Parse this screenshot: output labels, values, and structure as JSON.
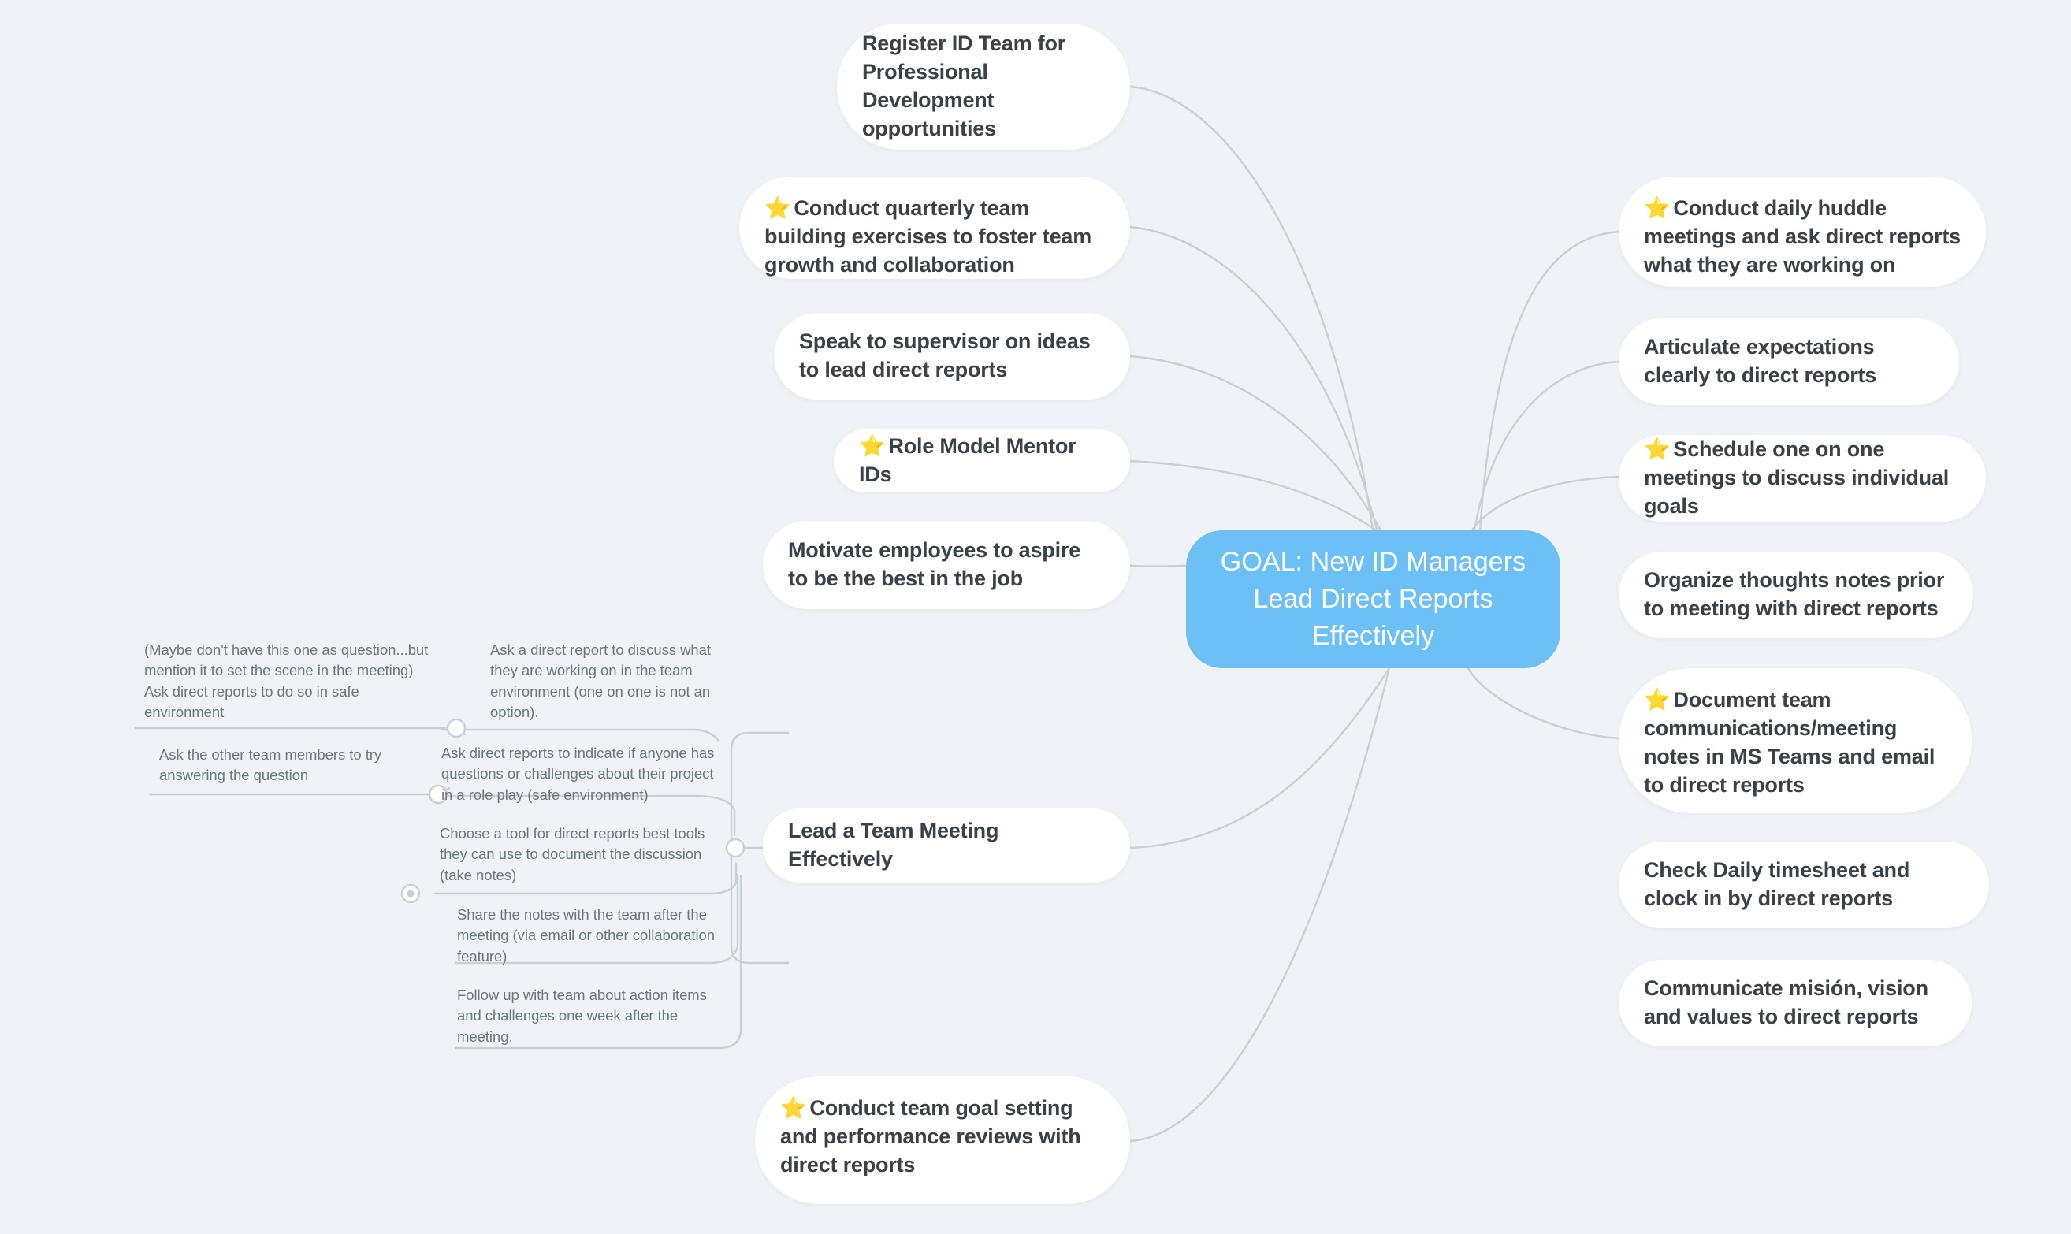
{
  "canvas": {
    "background": "#eff3f7",
    "link_color": "#c9d0d6",
    "card_color": "#ffffff",
    "card_text_color": "#394249",
    "leaf_text_color": "#6b7780",
    "center_color": "#6cc0f5",
    "center_text_color": "#ffffff"
  },
  "center": {
    "title": "GOAL: New ID Managers Lead Direct Reports Effectively"
  },
  "star_glyph": "⭐",
  "left_branches": [
    {
      "id": "register-id-team",
      "star": false,
      "text": "Register ID Team for Professional Development opportunities"
    },
    {
      "id": "quarterly-team-building",
      "star": true,
      "text": "Conduct quarterly team building exercises to foster team growth and collaboration"
    },
    {
      "id": "speak-to-supervisor",
      "star": false,
      "text": "Speak to supervisor on ideas to lead direct reports"
    },
    {
      "id": "role-model-mentor-ids",
      "star": true,
      "text": "Role Model Mentor IDs"
    },
    {
      "id": "motivate-employees",
      "star": false,
      "text": "Motivate employees to aspire to be the best in the job"
    },
    {
      "id": "lead-team-meeting",
      "star": false,
      "text": "Lead a Team Meeting Effectively"
    },
    {
      "id": "team-goal-setting",
      "star": true,
      "text": "Conduct team goal setting and performance reviews with direct reports"
    }
  ],
  "right_branches": [
    {
      "id": "daily-huddle",
      "star": true,
      "text": "Conduct daily huddle meetings and ask direct reports what they are working on"
    },
    {
      "id": "articulate-expectations",
      "star": false,
      "text": "Articulate expectations clearly to direct reports"
    },
    {
      "id": "one-on-one-meetings",
      "star": true,
      "text": "Schedule one on one meetings to discuss individual goals"
    },
    {
      "id": "organize-thoughts",
      "star": false,
      "text": "Organize thoughts notes prior to meeting with direct reports"
    },
    {
      "id": "document-team-comms",
      "star": true,
      "text": "Document team communications/meeting notes in MS Teams and email to direct reports"
    },
    {
      "id": "check-daily-timesheet",
      "star": false,
      "text": "Check Daily timesheet and clock in by direct reports"
    },
    {
      "id": "communicate-mission",
      "star": false,
      "text": "Communicate  misión, vision and values to direct reports"
    }
  ],
  "meeting_subnodes": [
    {
      "id": "maybe-dont-have",
      "text": "(Maybe don't have this one as question...but mention it to set the scene in the meeting) Ask direct reports to do so in safe environment"
    },
    {
      "id": "ask-other-team-members",
      "text": "Ask the other team members to try answering the question"
    },
    {
      "id": "ask-direct-report-discuss",
      "text": "Ask a direct report to discuss what they are working on in the team environment (one on one is not an option)."
    },
    {
      "id": "ask-indicate-questions",
      "text": "Ask direct reports to indicate if anyone has questions or challenges about their project in a role play (safe environment)"
    },
    {
      "id": "choose-a-tool",
      "text": "Choose a tool for direct reports best tools they can use to document the discussion (take notes)"
    },
    {
      "id": "share-the-notes",
      "text": "Share the notes with the team after the meeting (via email or other collaboration feature)"
    },
    {
      "id": "follow-up-with-team",
      "text": "Follow up with team about action items and challenges one week after the meeting."
    }
  ]
}
